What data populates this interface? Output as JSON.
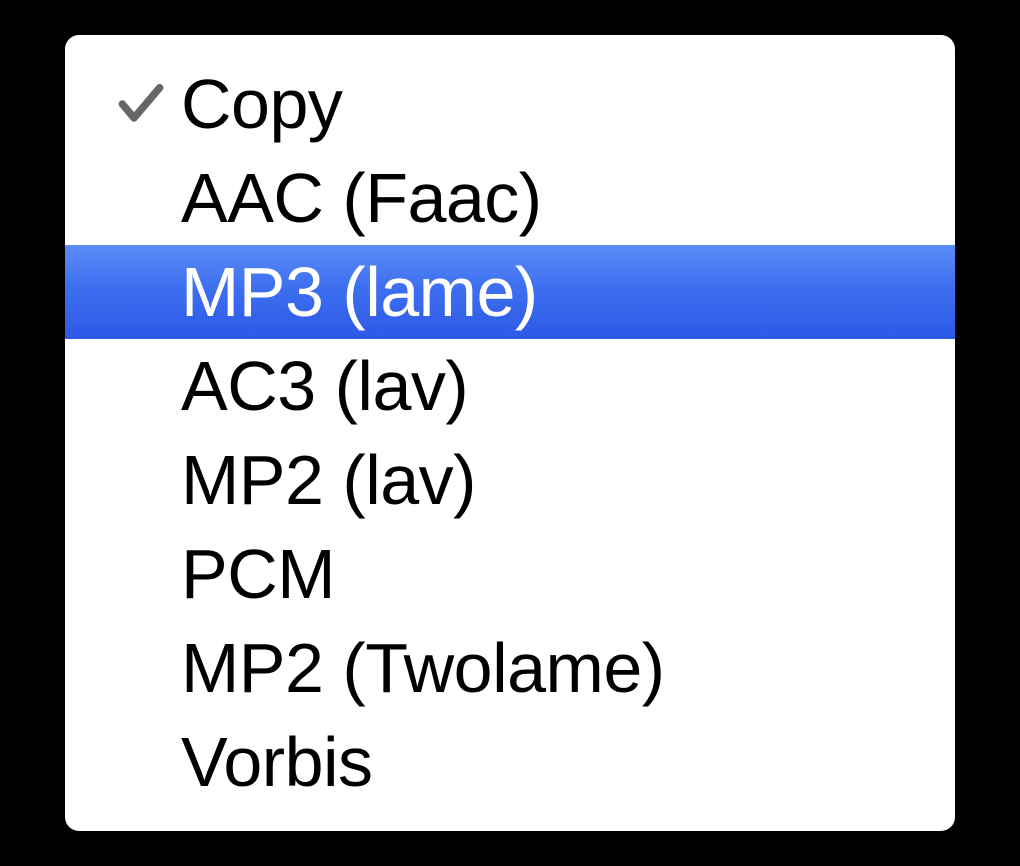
{
  "menu": {
    "items": [
      {
        "label": "Copy",
        "checked": true,
        "highlighted": false
      },
      {
        "label": "AAC (Faac)",
        "checked": false,
        "highlighted": false
      },
      {
        "label": "MP3 (lame)",
        "checked": false,
        "highlighted": true
      },
      {
        "label": "AC3 (lav)",
        "checked": false,
        "highlighted": false
      },
      {
        "label": "MP2 (lav)",
        "checked": false,
        "highlighted": false
      },
      {
        "label": "PCM",
        "checked": false,
        "highlighted": false
      },
      {
        "label": "MP2 (Twolame)",
        "checked": false,
        "highlighted": false
      },
      {
        "label": "Vorbis",
        "checked": false,
        "highlighted": false
      }
    ]
  }
}
